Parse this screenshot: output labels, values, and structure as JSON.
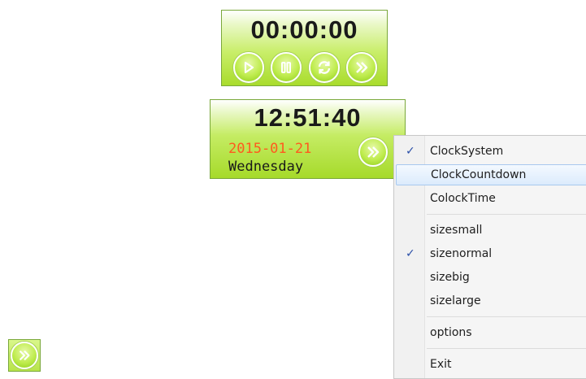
{
  "stopwatch": {
    "time": "00:00:00",
    "buttons": [
      "play-icon",
      "pause-icon",
      "refresh-icon",
      "forward-icon"
    ]
  },
  "clock": {
    "time": "12:51:40",
    "date": "2015-01-21",
    "weekday": "Wednesday",
    "date_color": "#ff5a1e"
  },
  "menu": {
    "items": [
      {
        "label": "ClockSystem",
        "checked": true
      },
      {
        "label": "ClockCountdown",
        "checked": false,
        "highlighted": true
      },
      {
        "label": "ColockTime",
        "checked": false
      },
      {
        "label": "sizesmall",
        "checked": false
      },
      {
        "label": "sizenormal",
        "checked": true
      },
      {
        "label": "sizebig",
        "checked": false
      },
      {
        "label": "sizelarge",
        "checked": false
      },
      {
        "label": "options",
        "checked": false
      },
      {
        "label": "Exit",
        "checked": false
      }
    ],
    "check_glyph": "✓"
  },
  "colors": {
    "widget_green": "#a9dc2c",
    "menu_highlight": "#dcebfc",
    "check_blue": "#2a4fa8"
  }
}
